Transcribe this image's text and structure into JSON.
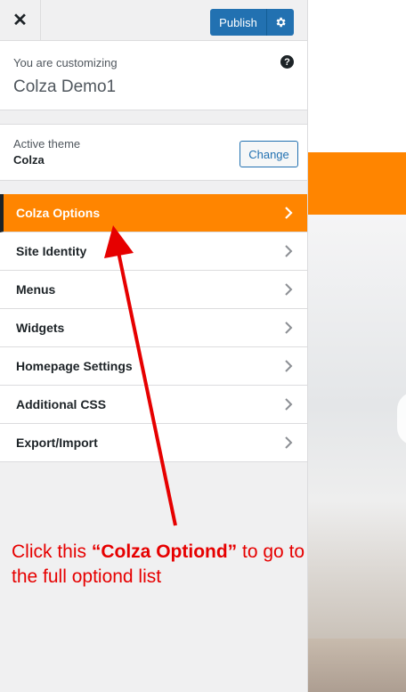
{
  "header": {
    "close_label": "✕",
    "publish_label": "Publish"
  },
  "customizing": {
    "label": "You are customizing",
    "site_title": "Colza Demo1",
    "help_icon_glyph": "?"
  },
  "theme": {
    "label": "Active theme",
    "name": "Colza",
    "change_label": "Change"
  },
  "menu": {
    "items": [
      {
        "label": "Colza Options"
      },
      {
        "label": "Site Identity"
      },
      {
        "label": "Menus"
      },
      {
        "label": "Widgets"
      },
      {
        "label": "Homepage Settings"
      },
      {
        "label": "Additional CSS"
      },
      {
        "label": "Export/Import"
      }
    ]
  },
  "annotation": {
    "prefix": "Click this ",
    "highlight": "“Colza Optiond”",
    "suffix": " to go to the full optiond list"
  },
  "colors": {
    "accent": "#ff8500",
    "primary": "#2271b1",
    "annotation": "#e60000"
  },
  "icons": {
    "close": "close-icon",
    "gear": "gear-icon",
    "help": "help-icon",
    "chevron": "chevron-right-icon"
  }
}
